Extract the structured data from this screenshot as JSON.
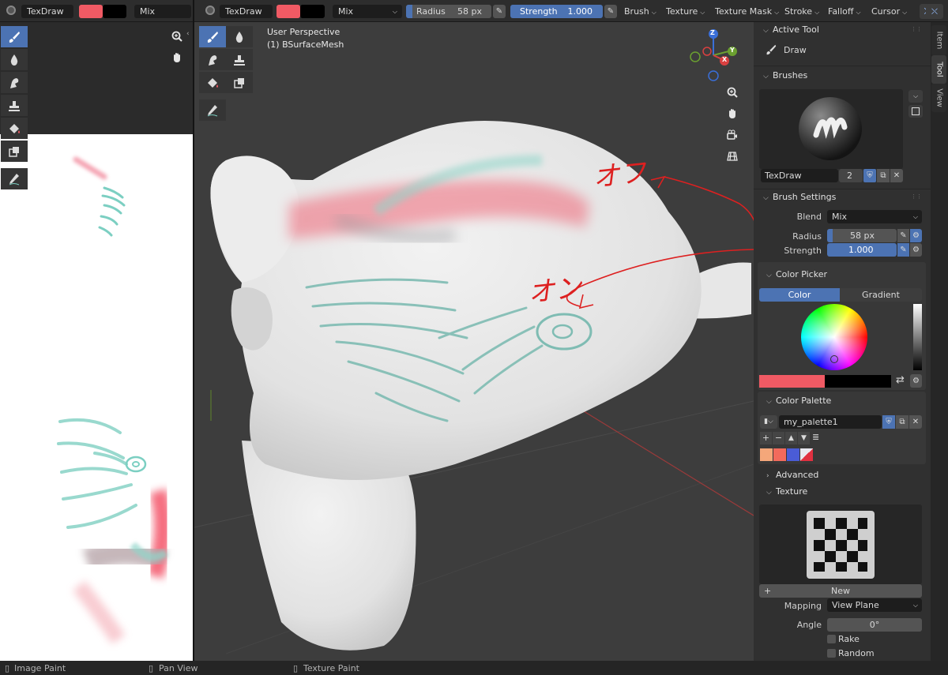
{
  "image_header": {
    "brush_name": "TexDraw",
    "blend": "Mix"
  },
  "view3d_header": {
    "brush_name": "TexDraw",
    "blend": "Mix",
    "radius_label": "Radius",
    "radius_value": "58 px",
    "strength_label": "Strength",
    "strength_value": "1.000",
    "menus": [
      "Brush",
      "Texture",
      "Texture Mask",
      "Stroke",
      "Falloff",
      "Cursor"
    ]
  },
  "viewport": {
    "perspective": "User Perspective",
    "object_info": "(1) BSurfaceMesh",
    "gizmo": {
      "z": "Z",
      "y": "Y",
      "x": "X"
    }
  },
  "annotations": {
    "off_text": "オフ",
    "on_text": "オン"
  },
  "colors": {
    "primary": "#f05a64",
    "secondary": "#000000",
    "accent": "#4c73b3",
    "annotation": "#dd2020"
  },
  "sidebar": {
    "tabs": [
      "Item",
      "Tool",
      "View"
    ],
    "active_tool": {
      "title": "Active Tool",
      "name": "Draw"
    },
    "brushes": {
      "title": "Brushes",
      "name": "TexDraw",
      "users": "2"
    },
    "brush_settings": {
      "title": "Brush Settings",
      "blend_label": "Blend",
      "blend_value": "Mix",
      "radius_label": "Radius",
      "radius_value": "58 px",
      "strength_label": "Strength",
      "strength_value": "1.000"
    },
    "color_picker": {
      "title": "Color Picker",
      "tab_color": "Color",
      "tab_gradient": "Gradient"
    },
    "color_palette": {
      "title": "Color Palette",
      "name": "my_palette1",
      "swatches": [
        "#f4a77a",
        "#f26a5c",
        "#4a5cd6",
        "#e8e8f0"
      ]
    },
    "advanced": {
      "title": "Advanced"
    },
    "texture": {
      "title": "Texture",
      "new_label": "New",
      "mapping_label": "Mapping",
      "mapping_value": "View Plane",
      "angle_label": "Angle",
      "angle_value": "0°",
      "rake_label": "Rake",
      "random_label": "Random"
    }
  },
  "status_bar": {
    "items": [
      "Image Paint",
      "Pan View",
      "Texture Paint"
    ]
  }
}
